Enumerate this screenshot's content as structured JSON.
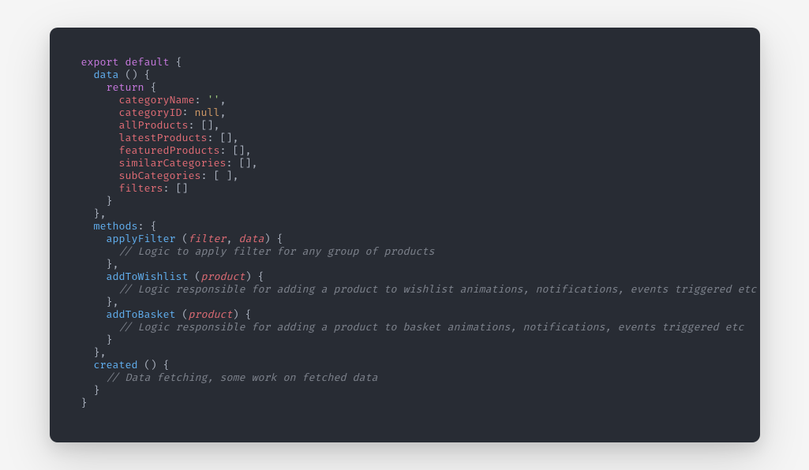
{
  "code": {
    "kw_export": "export",
    "kw_default": "default",
    "kw_return": "return",
    "fn_data": "data",
    "fn_methods": "methods",
    "fn_created": "created",
    "fn_applyFilter": "applyFilter",
    "fn_addToWishlist": "addToWishlist",
    "fn_addToBasket": "addToBasket",
    "prop_categoryName": "categoryName",
    "prop_categoryID": "categoryID",
    "prop_allProducts": "allProducts",
    "prop_latestProducts": "latestProducts",
    "prop_featuredProducts": "featuredProducts",
    "prop_similarCategories": "similarCategories",
    "prop_subCategories": "subCategories",
    "prop_filters": "filters",
    "val_emptyStr": "''",
    "val_null": "null",
    "param_filter": "filter",
    "param_data": "data",
    "param_product": "product",
    "com_applyFilter": "// Logic to apply filter for any group of products",
    "com_wishlist": "// Logic responsible for adding a product to wishlist animations, notifications, events triggered etc",
    "com_basket": "// Logic responsible for adding a product to basket animations, notifications, events triggered etc",
    "com_created": "// Data fetching, some work on fetched data"
  }
}
